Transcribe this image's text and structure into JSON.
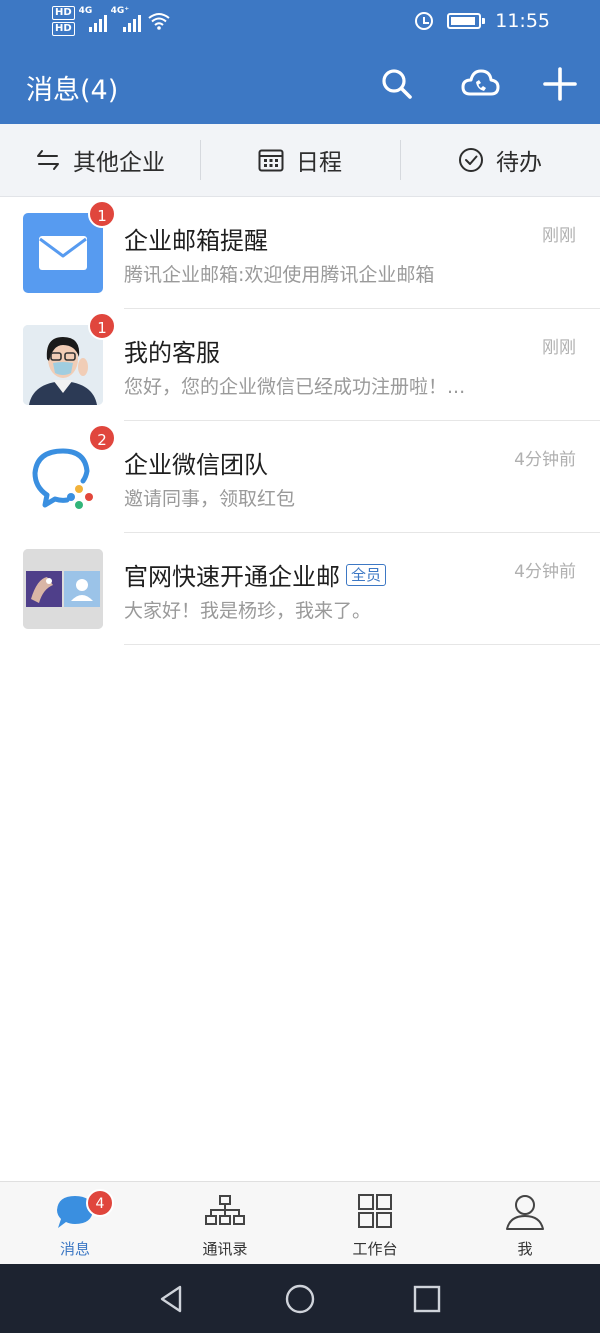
{
  "status_bar": {
    "hd1": "HD",
    "hd2": "HD",
    "net1": "4G",
    "net2": "4G⁺",
    "time": "11:55"
  },
  "header": {
    "title": "消息(4)",
    "icons": [
      "search-icon",
      "cloud-phone-icon",
      "plus-icon"
    ]
  },
  "quick_tabs": [
    {
      "label": "其他企业",
      "icon": "swap-icon"
    },
    {
      "label": "日程",
      "icon": "calendar-icon"
    },
    {
      "label": "待办",
      "icon": "check-circle-icon"
    }
  ],
  "messages": [
    {
      "name": "企业邮箱提醒",
      "preview": "腾讯企业邮箱:欢迎使用腾讯企业邮箱",
      "time": "刚刚",
      "badge": "1"
    },
    {
      "name": "我的客服",
      "preview": "您好，您的企业微信已经成功注册啦！...",
      "time": "刚刚",
      "badge": "1"
    },
    {
      "name": "企业微信团队",
      "preview": "邀请同事，领取红包",
      "time": "4分钟前",
      "badge": "2"
    },
    {
      "name": "官网快速开通企业邮",
      "tag": "全员",
      "preview": "大家好！我是杨珍，我来了。",
      "time": "4分钟前",
      "badge": ""
    }
  ],
  "bottom_nav": [
    {
      "label": "消息",
      "badge": "4",
      "active": true
    },
    {
      "label": "通讯录"
    },
    {
      "label": "工作台"
    },
    {
      "label": "我"
    }
  ],
  "colors": {
    "brand_blue": "#3d78c4",
    "badge_red": "#e0463d",
    "system_nav": "#1d2330"
  }
}
